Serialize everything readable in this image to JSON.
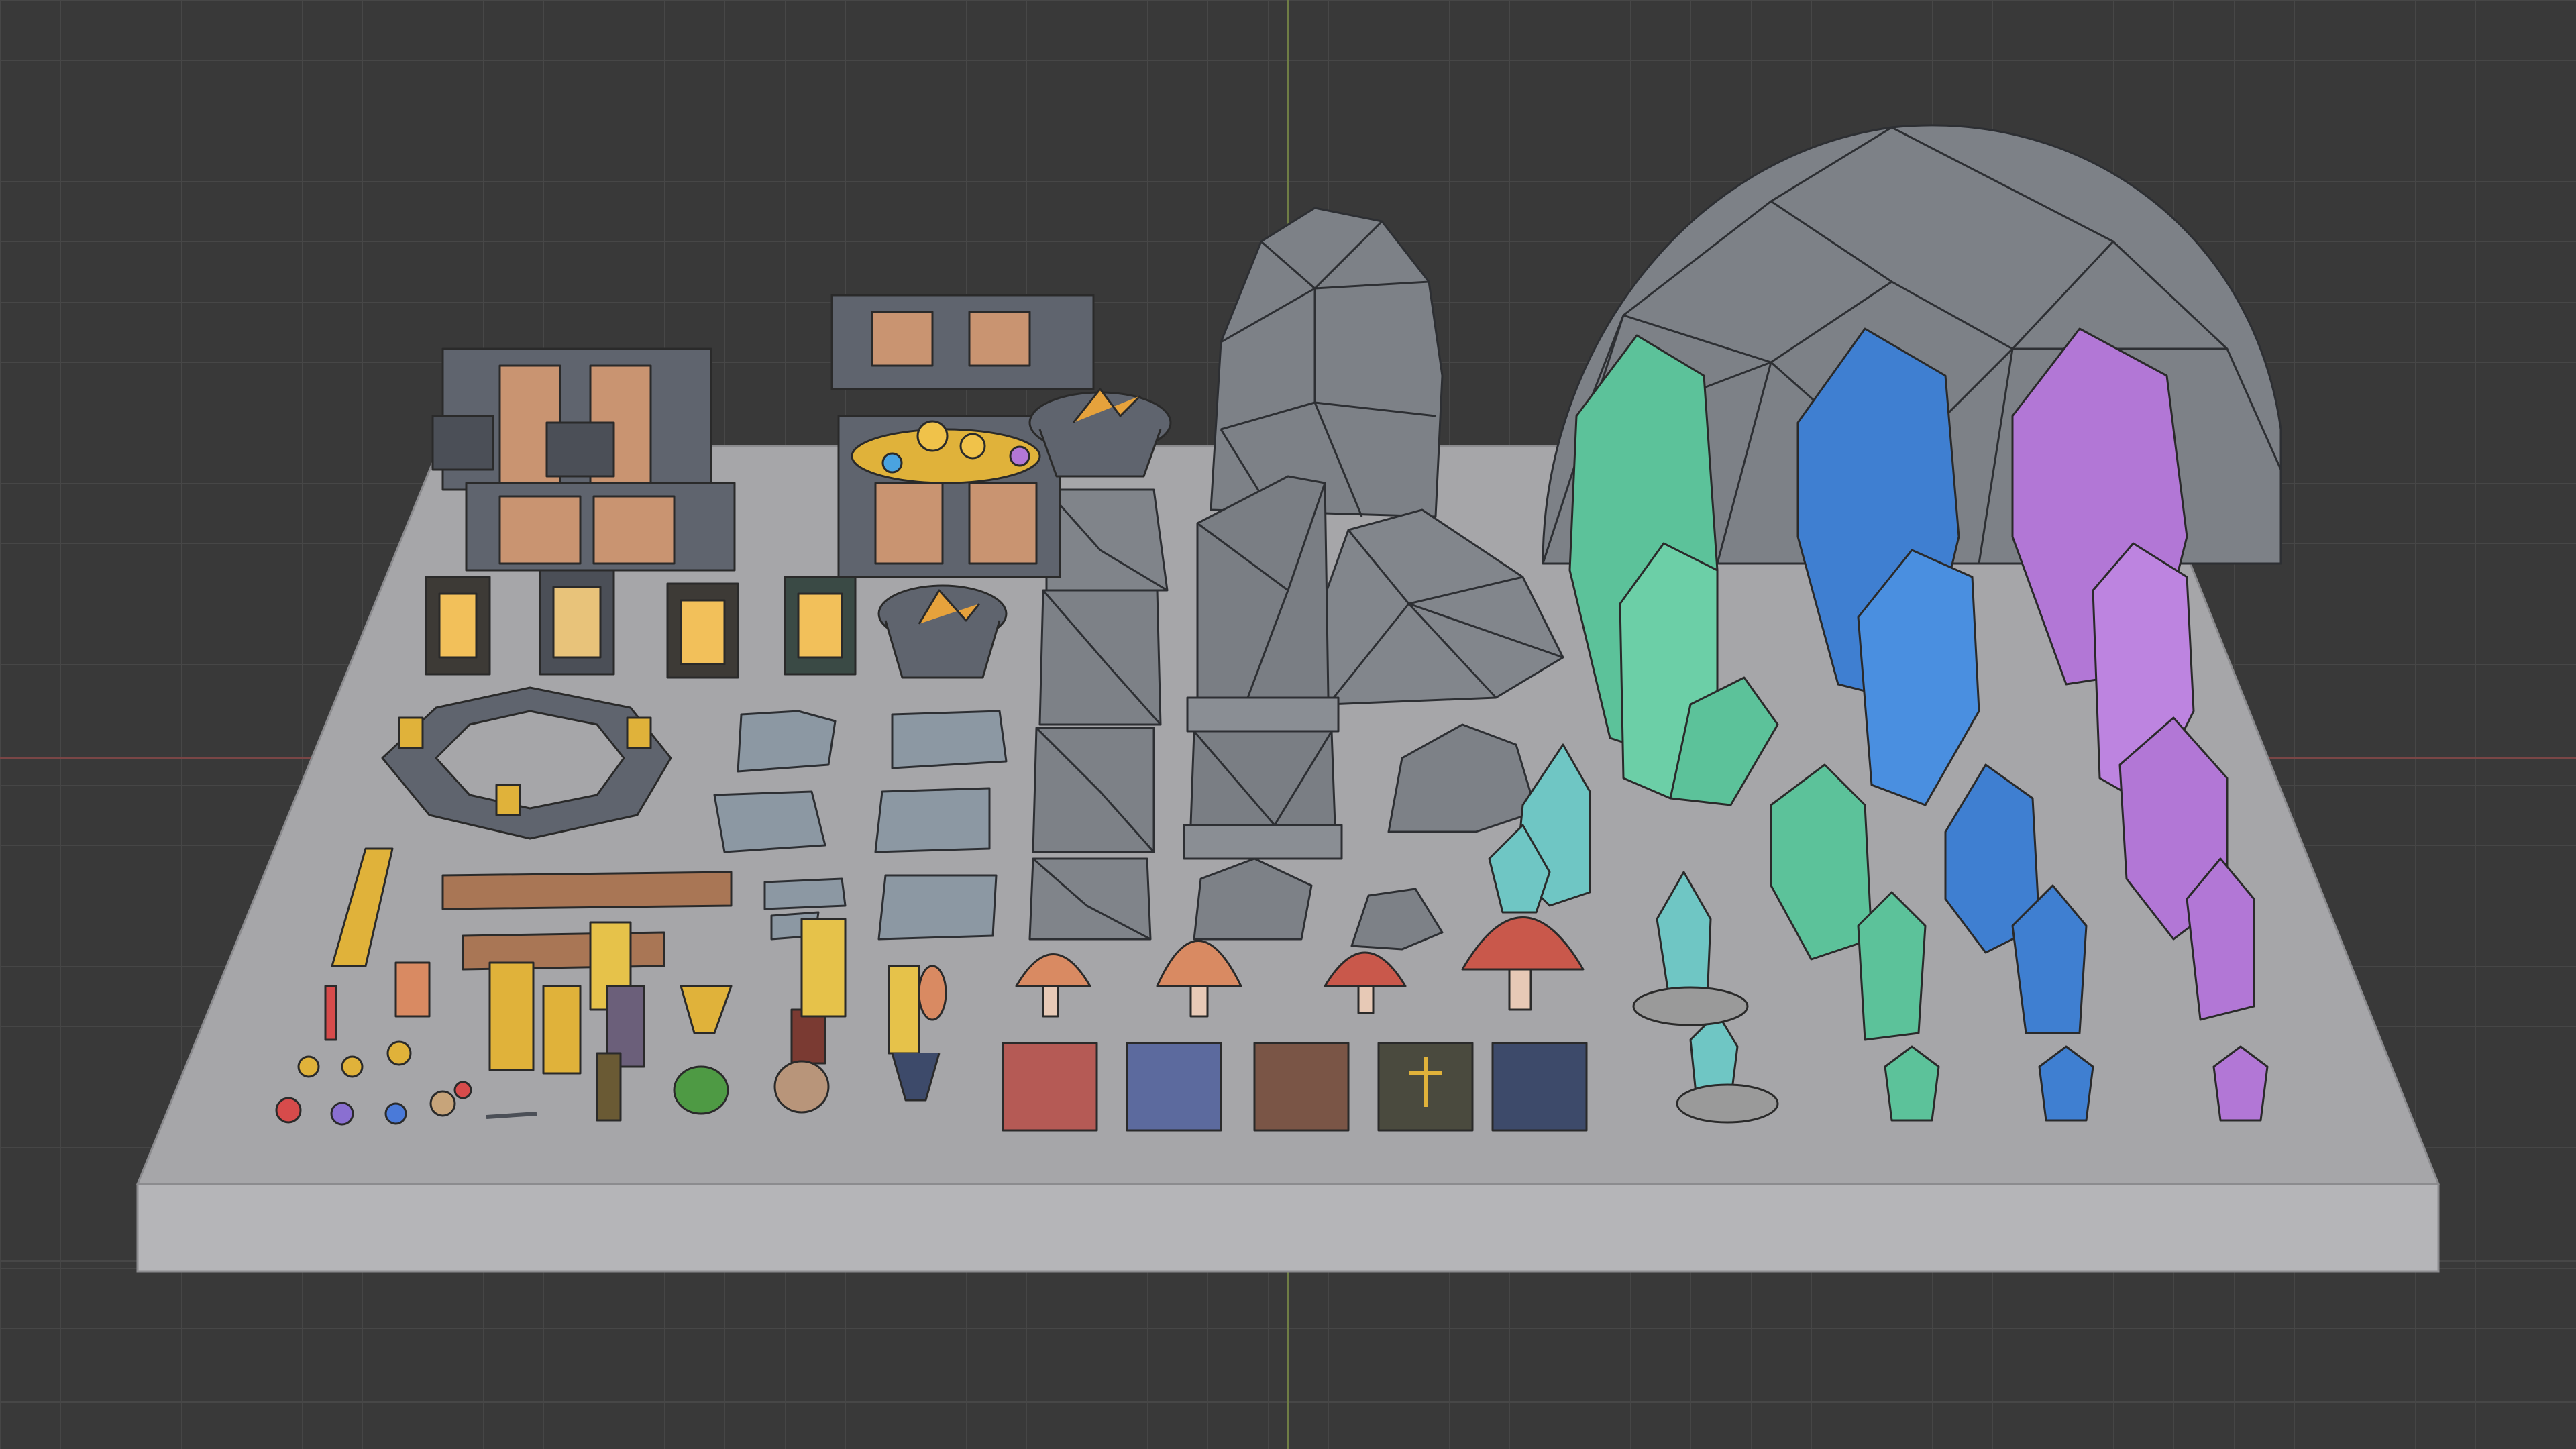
{
  "viewport": {
    "background_color": "#3a3a3a",
    "grid_color": "#4a4a4a",
    "x_axis_color": "#8a4a4a",
    "y_axis_color": "#7d8a4a"
  },
  "base": {
    "top_color": "#a9a9ab",
    "front_color": "#b8b8ba",
    "edge_color": "#8c8c8e"
  },
  "materials": {
    "stone": "#7d8187",
    "wood": "#b07d5c",
    "iron": "#5f646e",
    "gold": "#e0b23a",
    "crystal_green": "#5cc29a",
    "crystal_blue": "#3f7fd1",
    "crystal_purple": "#b277d6",
    "crystal_cyan": "#6fc6c4",
    "mushroom_orange": "#d98a62",
    "mushroom_red": "#c9584b",
    "book_red": "#b55a55",
    "book_blue": "#5c6a9e",
    "book_brown": "#7a5546",
    "book_dark": "#4a4a3e",
    "book_navy": "#3d4a6a"
  },
  "props": [
    "treasure-chest-closed",
    "treasure-chest-open",
    "lanterns",
    "chandelier",
    "braziers",
    "stone-blocks",
    "large-rocks",
    "dome-rock",
    "flat-stones",
    "crystal-clusters",
    "mushrooms",
    "books",
    "small-items"
  ]
}
